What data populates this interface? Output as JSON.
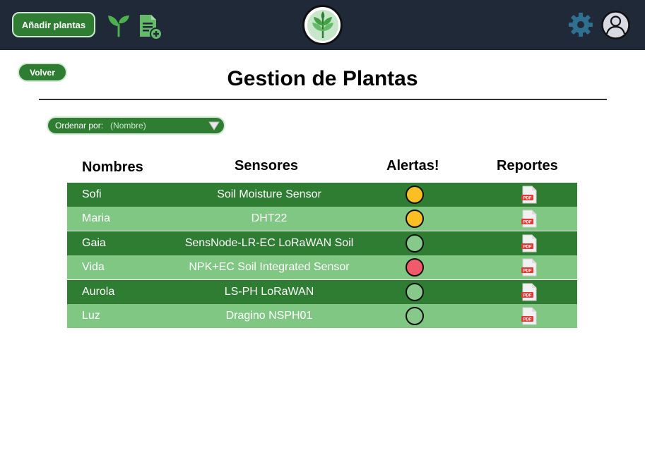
{
  "header": {
    "add_button": "Añadir plantas",
    "icons": [
      "sprout-icon",
      "document-add-icon",
      "plant-logo",
      "gear-icon",
      "user-avatar-icon"
    ]
  },
  "back_button": "Volver",
  "page_title": "Gestion de Plantas",
  "sort": {
    "label": "Ordenar por:",
    "value": "(Nombre)"
  },
  "table": {
    "headers": {
      "names": "Nombres",
      "sensors": "Sensores",
      "alerts": "Alertas!",
      "reports": "Reportes"
    },
    "rows": [
      {
        "name": "Sofi",
        "sensor": "Soil Moisture Sensor",
        "alert_color": "#fbbf24",
        "report_icon": "pdf-icon"
      },
      {
        "name": "Maria",
        "sensor": "DHT22",
        "alert_color": "#fbbf24",
        "report_icon": "pdf-icon"
      },
      {
        "name": "Gaia",
        "sensor": "SensNode-LR-EC LoRaWAN Soil",
        "alert_color": "#86c98a",
        "report_icon": "pdf-icon"
      },
      {
        "name": "Vida",
        "sensor": "NPK+EC Soil Integrated Sensor",
        "alert_color": "#f05a6a",
        "report_icon": "pdf-icon"
      },
      {
        "name": "Aurola",
        "sensor": "LS-PH LoRaWAN",
        "alert_color": "#86c98a",
        "report_icon": "pdf-icon"
      },
      {
        "name": "Luz",
        "sensor": "Dragino NSPH01",
        "alert_color": "#86c98a",
        "report_icon": "pdf-icon"
      }
    ]
  },
  "colors": {
    "header_bg": "#1f2937",
    "primary_green": "#2e7d32",
    "light_green": "#81c784",
    "gear": "#2f6f8f"
  }
}
